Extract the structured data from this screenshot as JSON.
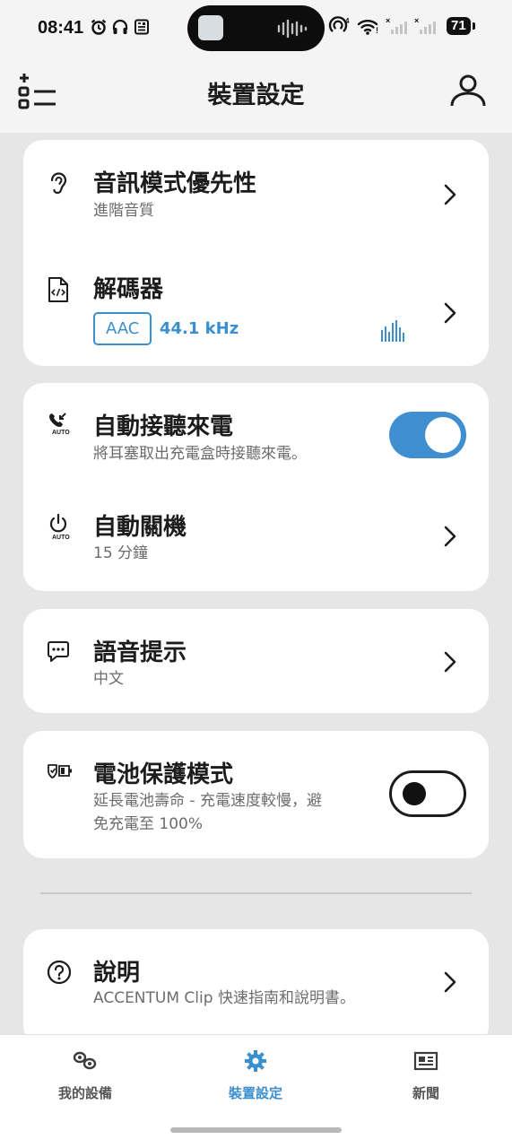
{
  "status_bar": {
    "time": "08:41",
    "battery": "71"
  },
  "header": {
    "title": "裝置設定"
  },
  "cards": {
    "audio_priority": {
      "title": "音訊模式優先性",
      "subtitle": "進階音質"
    },
    "codec": {
      "title": "解碼器",
      "codec": "AAC",
      "sample_rate": "44.1 kHz"
    },
    "auto_answer": {
      "title": "自動接聽來電",
      "subtitle": "將耳塞取出充電盒時接聽來電。",
      "enabled": true,
      "icon_badge": "AUTO"
    },
    "auto_off": {
      "title": "自動關機",
      "subtitle": "15 分鐘",
      "icon_badge": "AUTO"
    },
    "voice_prompt": {
      "title": "語音提示",
      "subtitle": "中文"
    },
    "battery_protect": {
      "title": "電池保護模式",
      "subtitle_line1": "延長電池壽命 - 充電速度較慢，避",
      "subtitle_line2": "免充電至 100%",
      "enabled": false
    },
    "help": {
      "title": "說明",
      "subtitle": "ACCENTUM Clip 快速指南和說明書。"
    }
  },
  "bottom_nav": {
    "items": [
      {
        "label": "我的設備",
        "active": false
      },
      {
        "label": "裝置設定",
        "active": true
      },
      {
        "label": "新聞",
        "active": false
      }
    ]
  },
  "colors": {
    "accent": "#3b8fcf",
    "background": "#e6e6e6",
    "card": "#ffffff"
  }
}
